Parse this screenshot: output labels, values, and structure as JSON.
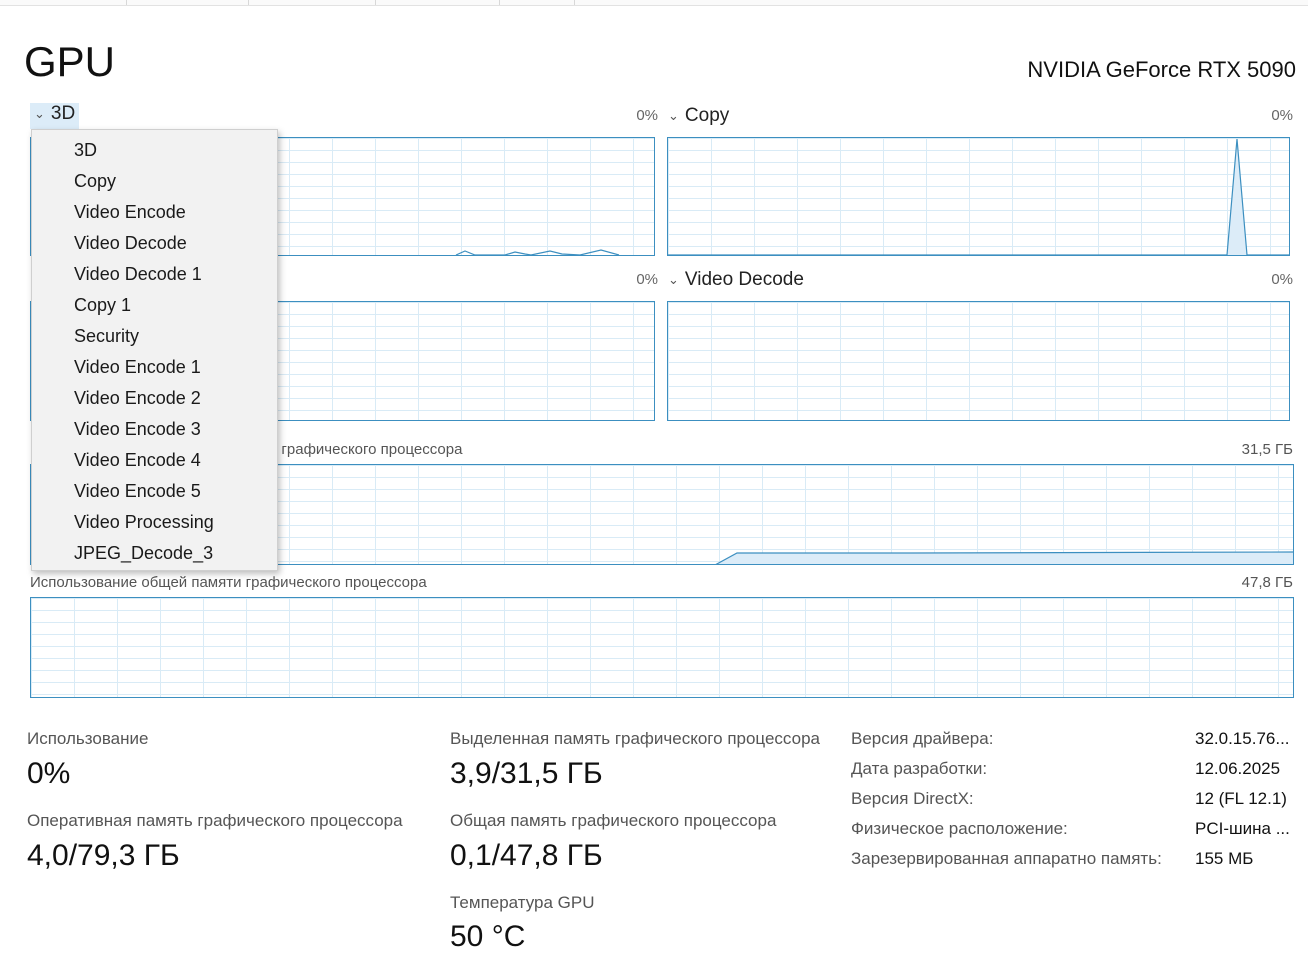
{
  "page_title": "GPU",
  "device_name": "NVIDIA GeForce RTX 5090",
  "engines": [
    {
      "selector_label": "3D",
      "percent": "0%"
    },
    {
      "selector_label": "Copy",
      "percent": "0%"
    },
    {
      "selector_label": "",
      "percent": "0%"
    },
    {
      "selector_label": "Video Decode",
      "percent": "0%"
    }
  ],
  "dedicated_memory_graph": {
    "label": "Использование выделенной памяти графического процессора",
    "visible_label": "ти графического процессора",
    "max": "31,5 ГБ"
  },
  "shared_memory_graph": {
    "label": "Использование общей памяти графического процессора",
    "max": "47,8 ГБ"
  },
  "dropdown": {
    "options": [
      "3D",
      "Copy",
      "Video Encode",
      "Video Decode",
      "Video Decode 1",
      "Copy 1",
      "Security",
      "Video Encode 1",
      "Video Encode 2",
      "Video Encode 3",
      "Video Encode 4",
      "Video Encode 5",
      "Video Processing",
      "JPEG_Decode_3"
    ]
  },
  "stats": {
    "usage": {
      "label": "Использование",
      "value": "0%"
    },
    "gpu_ram": {
      "label": "Оперативная память графического процессора",
      "value": "4,0/79,3 ГБ"
    },
    "dedicated": {
      "label": "Выделенная память графического процессора",
      "value": "3,9/31,5 ГБ"
    },
    "shared": {
      "label": "Общая память графического процессора",
      "value": "0,1/47,8 ГБ"
    },
    "temperature": {
      "label": "Температура GPU",
      "value": "50 °C"
    }
  },
  "details": [
    {
      "key": "Версия драйвера:",
      "value": "32.0.15.76..."
    },
    {
      "key": "Дата разработки:",
      "value": "12.06.2025"
    },
    {
      "key": "Версия DirectX:",
      "value": "12 (FL 12.1)"
    },
    {
      "key": "Физическое расположение:",
      "value": "PCI-шина ..."
    },
    {
      "key": "Зарезервированная аппаратно память:",
      "value": "155 МБ"
    }
  ],
  "colors": {
    "graph_line": "#3c8fc0",
    "graph_fill": "#dcecf8",
    "grid": "#d9ebf6",
    "dropdown_bg": "#f2f2f2"
  }
}
